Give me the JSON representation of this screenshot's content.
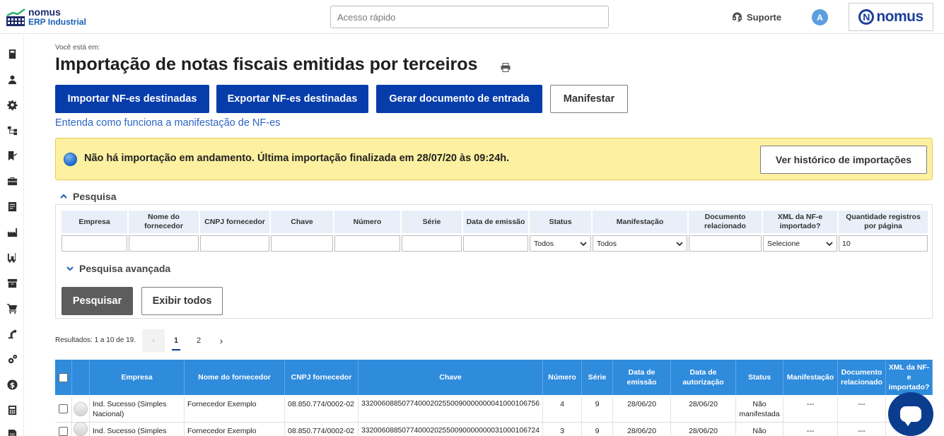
{
  "header": {
    "logo_line1": "nomus",
    "logo_line2": "ERP Industrial",
    "quick_placeholder": "Acesso rápido",
    "support_label": "Suporte",
    "avatar_initial": "A",
    "brand_letter": "N",
    "brand_word": "nomus"
  },
  "breadcrumb": "Você está em:",
  "page_title": "Importação de notas fiscais emitidas por terceiros",
  "actions": {
    "import": "Importar NF-es destinadas",
    "export": "Exportar NF-es destinadas",
    "generate": "Gerar documento de entrada",
    "manifest": "Manifestar"
  },
  "help_link": "Entenda como funciona a manifestação de NF-es",
  "alert": {
    "message": "Não há importação em andamento. Última importação finalizada em 28/07/20 às 09:24h.",
    "history_button": "Ver histórico de importações"
  },
  "search": {
    "section_title": "Pesquisa",
    "columns": [
      "Empresa",
      "Nome do fornecedor",
      "CNPJ fornecedor",
      "Chave",
      "Número",
      "Série",
      "Data de emissão",
      "Status",
      "Manifestação",
      "Documento relacionado",
      "XML da NF-e importado?",
      "Quantidade registros por página"
    ],
    "status_value": "Todos",
    "manifest_value": "Todos",
    "xml_value": "Selecione",
    "per_page_value": "10",
    "advanced_label": "Pesquisa avançada",
    "search_button": "Pesquisar",
    "show_all_button": "Exibir todos"
  },
  "pagination": {
    "results_text": "Resultados: 1 a 10 de 19.",
    "pages": [
      "1",
      "2"
    ],
    "prev": "‹",
    "next": "›"
  },
  "table": {
    "headers": [
      "Empresa",
      "Nome do fornecedor",
      "CNPJ fornecedor",
      "Chave",
      "Número",
      "Série",
      "Data de emissão",
      "Data de autorização",
      "Status",
      "Manifestação",
      "Documento relacionado",
      "XML da NF-e importado?"
    ],
    "rows": [
      {
        "empresa": "Ind. Sucesso (Simples Nacional)",
        "fornecedor": "Fornecedor Exemplo",
        "cnpj": "08.850.774/0002-02",
        "chave": "33200608850774000202550090000000041000106756",
        "numero": "4",
        "serie": "9",
        "emissao": "28/06/20",
        "autorizacao": "28/06/20",
        "status": "Não manifestada",
        "manifestacao": "---",
        "documento": "---"
      },
      {
        "empresa": "Ind. Sucesso (Simples",
        "fornecedor": "Fornecedor Exemplo",
        "cnpj": "08.850.774/0002-02",
        "chave": "33200608850774000202550090000000031000106724",
        "numero": "3",
        "serie": "9",
        "emissao": "28/06/20",
        "autorizacao": "28/06/20",
        "status": "Não",
        "manifestacao": "---",
        "documento": "---"
      }
    ]
  },
  "colors": {
    "primary": "#073dab",
    "table_header": "#2f8bdc",
    "alert_bg": "#fdf0a0",
    "link": "#2c64c4"
  },
  "sidebar_icons": [
    "book-icon",
    "user-icon",
    "settings-icon",
    "flow-icon",
    "bookmark-check-icon",
    "briefcase-icon",
    "document-icon",
    "factory-icon",
    "forklift-icon",
    "archive-icon",
    "cart-icon",
    "robot-arm-icon",
    "gears-icon",
    "dollar-icon",
    "calculator-icon",
    "report-icon"
  ]
}
